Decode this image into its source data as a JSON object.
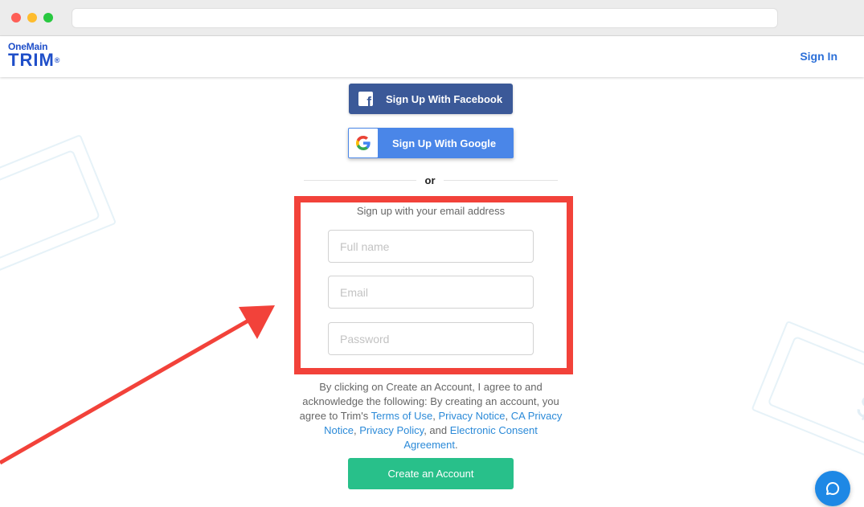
{
  "header": {
    "logo_top": "OneMain",
    "logo_main": "TRIM",
    "logo_mark": "®",
    "sign_in": "Sign In"
  },
  "social": {
    "facebook_label": "Sign Up With Facebook",
    "google_label": "Sign Up With Google",
    "facebook_color": "#3b5998",
    "google_color": "#4a86e8"
  },
  "divider": {
    "label": "or"
  },
  "form": {
    "title": "Sign up with your email address",
    "full_name_placeholder": "Full name",
    "email_placeholder": "Email",
    "password_placeholder": "Password",
    "highlight_color": "#f2423a"
  },
  "legal": {
    "intro": "By clicking on Create an Account, I agree to and acknowledge the following: By creating an account, you agree to Trim's ",
    "terms": "Terms of Use",
    "sep1": ", ",
    "privacy_notice": "Privacy Notice",
    "sep2": ", ",
    "ca_privacy_notice": "CA Privacy Notice",
    "sep3": ", ",
    "privacy_policy": "Privacy Policy",
    "sep4": ", and ",
    "consent": "Electronic Consent Agreement",
    "end": "."
  },
  "actions": {
    "create_account": "Create an Account",
    "create_color": "#28c08a"
  },
  "icons": {
    "facebook": "facebook-icon",
    "google": "google-icon",
    "chat": "chat-icon",
    "arrow": "arrow-annotation"
  }
}
